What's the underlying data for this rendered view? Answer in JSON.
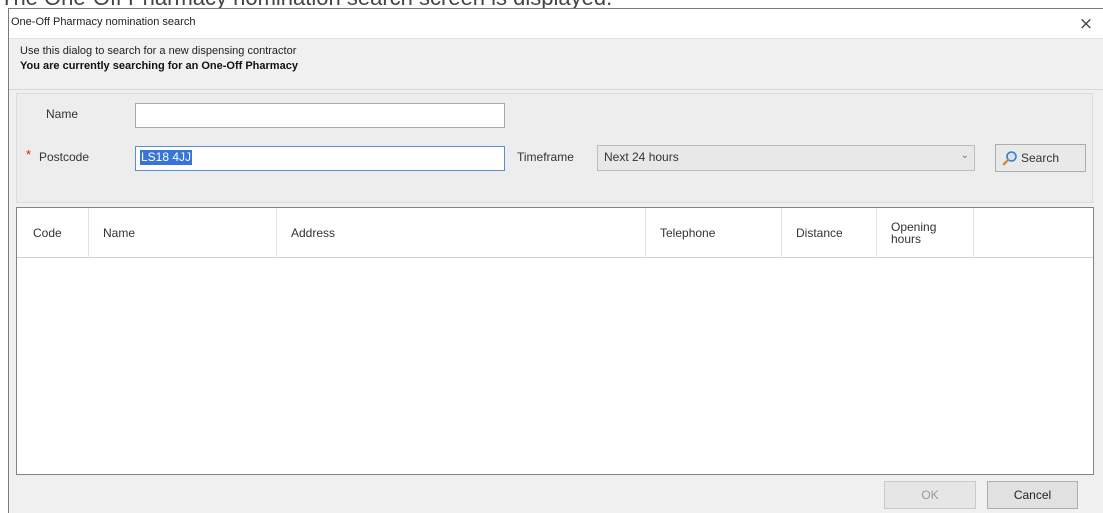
{
  "caption": "The One-Off Pharmacy nomination search screen is displayed.",
  "window": {
    "title": "One-Off Pharmacy nomination search",
    "close_glyph": "×"
  },
  "info": {
    "line1": "Use this dialog to search for a new dispensing contractor",
    "line2": "You are currently searching for an One-Off Pharmacy"
  },
  "form": {
    "name_label": "Name",
    "name_value": "",
    "postcode_required_mark": "*",
    "postcode_label": "Postcode",
    "postcode_value": "LS18 4JJ",
    "timeframe_label": "Timeframe",
    "timeframe_value": "Next 24 hours",
    "search_label": "Search"
  },
  "grid": {
    "columns": [
      {
        "key": "code",
        "label": "Code"
      },
      {
        "key": "name",
        "label": "Name"
      },
      {
        "key": "address",
        "label": "Address"
      },
      {
        "key": "telephone",
        "label": "Telephone"
      },
      {
        "key": "distance",
        "label": "Distance"
      },
      {
        "key": "opening_hours",
        "label": "Opening hours"
      }
    ],
    "rows": []
  },
  "footer": {
    "ok_label": "OK",
    "cancel_label": "Cancel"
  },
  "icons": {
    "search": "magnifier-icon",
    "close": "close-icon",
    "dropdown": "chevron-down-icon"
  }
}
